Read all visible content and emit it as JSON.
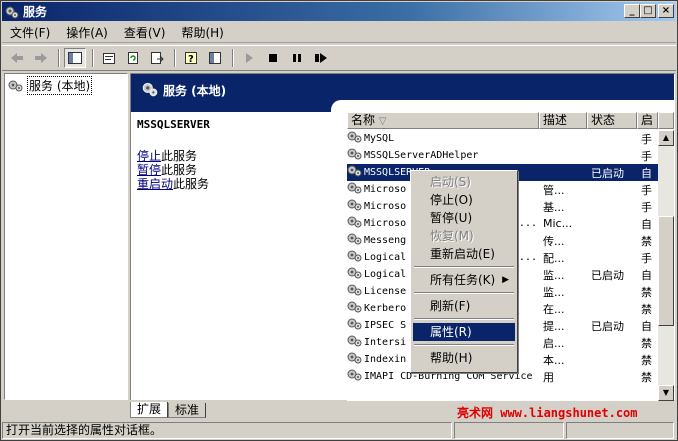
{
  "window": {
    "title": "服务",
    "controls": [
      "_",
      "□",
      "×"
    ]
  },
  "menubar": [
    "文件(F)",
    "操作(A)",
    "查看(V)",
    "帮助(H)"
  ],
  "toolbar": {
    "icons": [
      "back-arrow-icon",
      "forward-arrow-icon",
      "show-tree-icon",
      "properties-icon",
      "refresh-icon",
      "export-icon",
      "help-icon",
      "console-tree-icon",
      "start-icon",
      "stop-icon",
      "pause-icon",
      "restart-icon"
    ]
  },
  "tree": {
    "root_label": "服务 (本地)"
  },
  "details": {
    "header_title": "服务 (本地)",
    "selected_service": "MSSQLSERVER",
    "actions": [
      {
        "link": "停止",
        "suffix": "此服务"
      },
      {
        "link": "暂停",
        "suffix": "此服务"
      },
      {
        "link": "重启动",
        "suffix": "此服务"
      }
    ]
  },
  "list": {
    "columns": [
      "名称",
      "描述",
      "状态",
      "启"
    ],
    "sort_indicator": "▽",
    "rows": [
      {
        "name": "MySQL",
        "desc": "",
        "status": "",
        "start": "手"
      },
      {
        "name": "MSSQLServerADHelper",
        "desc": "",
        "status": "",
        "start": "手"
      },
      {
        "name": "MSSQLSERVER",
        "desc": "",
        "status": "已启动",
        "start": "自",
        "selected": true
      },
      {
        "name": "Microso",
        "desc": "管...",
        "status": "",
        "start": "手"
      },
      {
        "name": "Microso",
        "desc": "基...",
        "status": "",
        "start": "手"
      },
      {
        "name": "Microso",
        "suffix": "N...",
        "desc": "Mic...",
        "status": "",
        "start": "自"
      },
      {
        "name": "Messeng",
        "desc": "传...",
        "status": "",
        "start": "禁"
      },
      {
        "name": "Logical",
        "suffix": "a...",
        "desc": "配...",
        "status": "",
        "start": "手"
      },
      {
        "name": "Logical",
        "desc": "监...",
        "status": "已启动",
        "start": "自"
      },
      {
        "name": "License",
        "desc": "监...",
        "status": "",
        "start": "禁"
      },
      {
        "name": "Kerbero",
        "desc": "在...",
        "status": "",
        "start": "禁"
      },
      {
        "name": "IPSEC S",
        "desc": "提...",
        "status": "已启动",
        "start": "自"
      },
      {
        "name": "Intersi",
        "desc": "启...",
        "status": "",
        "start": "禁"
      },
      {
        "name": "Indexin",
        "desc": "本...",
        "status": "",
        "start": "禁"
      },
      {
        "name": "IMAPI CD-Burning COM Service",
        "desc": "用",
        "status": "",
        "start": "禁"
      }
    ]
  },
  "context_menu": {
    "items": [
      {
        "label": "启动(S)",
        "state": "disabled"
      },
      {
        "label": "停止(O)",
        "state": "normal"
      },
      {
        "label": "暂停(U)",
        "state": "normal"
      },
      {
        "label": "恢复(M)",
        "state": "disabled"
      },
      {
        "label": "重新启动(E)",
        "state": "normal"
      },
      {
        "sep": true
      },
      {
        "label": "所有任务(K)",
        "state": "normal",
        "submenu": true
      },
      {
        "sep": true
      },
      {
        "label": "刷新(F)",
        "state": "normal"
      },
      {
        "sep": true
      },
      {
        "label": "属性(R)",
        "state": "active"
      },
      {
        "sep": true
      },
      {
        "label": "帮助(H)",
        "state": "normal"
      }
    ]
  },
  "tabs": [
    "扩展",
    "标准"
  ],
  "watermark": "亮术网 www.liangshunet.com",
  "status_text": "打开当前选择的属性对话框。",
  "colors": {
    "selection": "#0a246a",
    "face": "#d4d0c8",
    "watermark": "#e00000"
  }
}
